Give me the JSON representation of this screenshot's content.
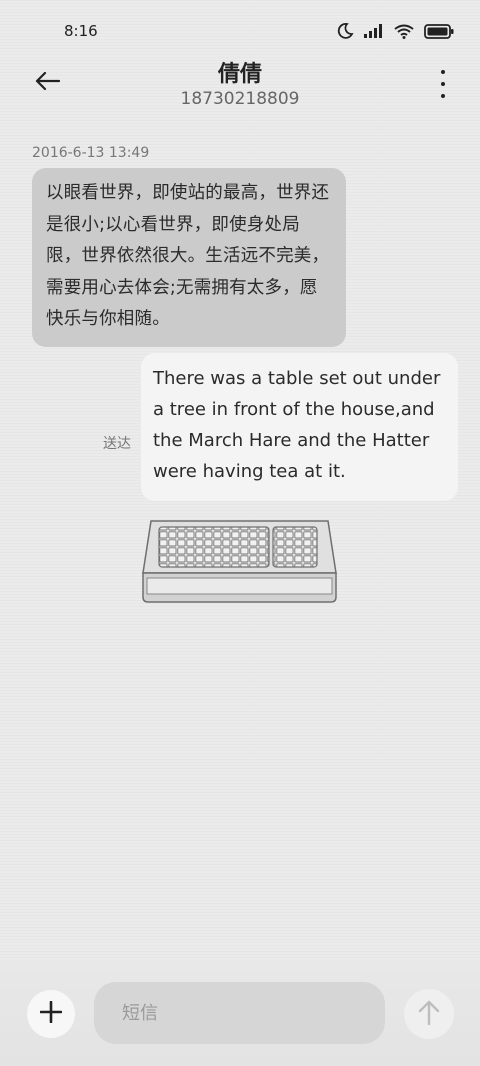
{
  "status_bar": {
    "time": "8:16",
    "icons": [
      "moon-icon",
      "signal-icon",
      "wifi-icon",
      "battery-icon"
    ]
  },
  "header": {
    "contact_name": "倩倩",
    "contact_number": "18730218809",
    "icons": [
      "back-arrow-icon",
      "more-vertical-icon"
    ]
  },
  "conversation": {
    "timestamp": "2016-6-13 13:49",
    "incoming_message": "以眼看世界，即使站的最高，世界还是很小;以心看世界，即使身处局限，世界依然很大。生活远不完美，需要用心去体会;无需拥有太多，愿快乐与你相随。",
    "outgoing_status": "送达",
    "outgoing_message": "There was a table set out under a tree in front of the house,and the March Hare and the Hatter were having tea at it.",
    "sticker": "keyboard-sticker"
  },
  "composer": {
    "placeholder": "短信",
    "value": "",
    "icons": [
      "plus-icon",
      "send-arrow-icon"
    ]
  },
  "colors": {
    "background": "#ebebeb",
    "incoming_bubble": "#cbcbcb",
    "outgoing_bubble": "#f4f4f4",
    "input_field": "#d6d6d6"
  }
}
